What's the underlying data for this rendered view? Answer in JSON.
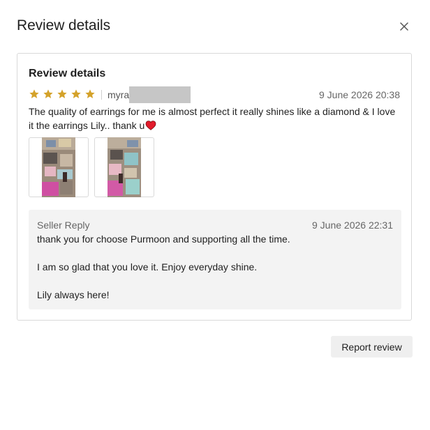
{
  "modal": {
    "title": "Review details",
    "close_icon": "close-icon"
  },
  "review": {
    "section_title": "Review details",
    "rating": 5,
    "max_rating": 5,
    "star_color": "#d4a22a",
    "reviewer_name": "myra",
    "date": "9 June 2026 20:38",
    "text": "The quality of earrings for me is almost perfect it really shines like a diamond & I love it the earrings Lily.. thank u",
    "emoji": "heart-icon",
    "images": [
      {
        "name": "review-photo-1"
      },
      {
        "name": "review-photo-2"
      }
    ]
  },
  "seller_reply": {
    "label": "Seller Reply",
    "date": "9 June 2026 22:31",
    "lines": [
      "thank you for choose Purmoon and supporting all the time.",
      "I am so glad that you love it. Enjoy everyday shine.",
      "Lily always here!"
    ]
  },
  "actions": {
    "report_label": "Report review"
  }
}
